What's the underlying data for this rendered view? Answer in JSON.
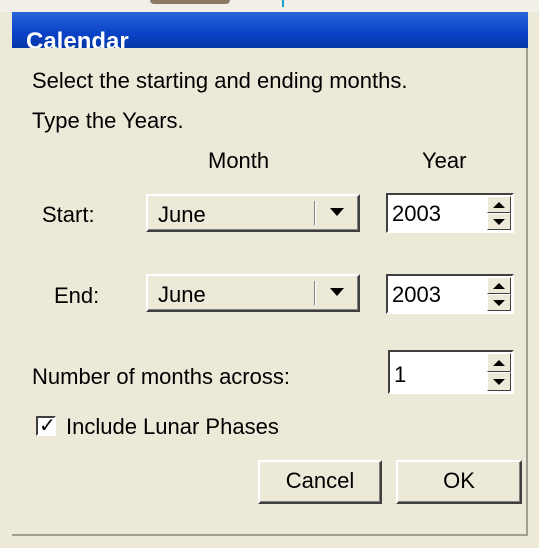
{
  "dialog": {
    "title": "Calendar"
  },
  "instructions": {
    "line1": "Select the starting and ending months.",
    "line2": "Type the Years."
  },
  "headers": {
    "month": "Month",
    "year": "Year"
  },
  "start": {
    "label": "Start:",
    "month": "June",
    "year": "2003"
  },
  "end": {
    "label": "End:",
    "month": "June",
    "year": "2003"
  },
  "months_across": {
    "label": "Number of months across:",
    "value": "1"
  },
  "lunar": {
    "label": "Include Lunar Phases",
    "checked": true
  },
  "buttons": {
    "cancel": "Cancel",
    "ok": "OK"
  },
  "colors": {
    "titlebar": "#0a44c9",
    "face": "#ece9d8"
  }
}
